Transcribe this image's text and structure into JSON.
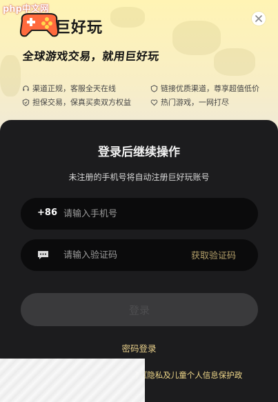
{
  "watermark": "php中文网",
  "brand": {
    "name": "巨好玩"
  },
  "slogan": "全球游戏交易，就用巨好玩",
  "features": [
    {
      "icon": "headset-icon",
      "text": "渠道正规，客服全天在线"
    },
    {
      "icon": "shield-icon",
      "text": "链接优质渠道，尊享超值低价"
    },
    {
      "icon": "check-shield-icon",
      "text": "担保交易，保真买卖双方权益"
    },
    {
      "icon": "heart-icon",
      "text": "热门游戏，一网打尽"
    }
  ],
  "login": {
    "title": "登录后继续操作",
    "subtitle": "未注册的手机号将自动注册巨好玩账号",
    "phone": {
      "prefix": "+86",
      "placeholder": "请输入手机号"
    },
    "code": {
      "placeholder": "请输入验证码",
      "get_code": "获取验证码"
    },
    "submit": "登录",
    "password_login": "密码登录",
    "agreement_visible": "》《隐私及儿童个人信息保护政"
  },
  "colors": {
    "accent": "#e8cf8a",
    "panel": "#1c1c1e",
    "hero": "#fff4b4",
    "field": "#0b0b0c"
  }
}
